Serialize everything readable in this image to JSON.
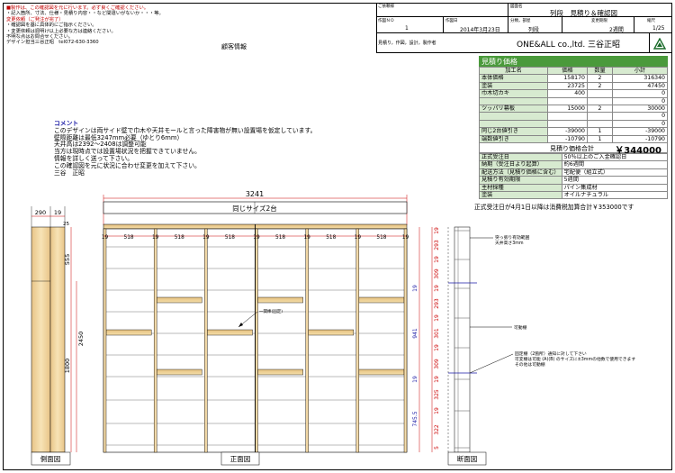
{
  "notes": {
    "red_lines": [
      {
        "prefix": "■",
        "text": "製作は、この確認図を元に行います。必ず良くご確認ください。"
      },
      {
        "prefix": "",
        "text": "・記入箇所、寸法、仕様・見積り内容・・など間違いがないか・・・等。"
      },
      {
        "prefix": "",
        "text": "変更依頼（ご発注が完了）"
      },
      {
        "prefix": "",
        "text": "・確認図を基に具体的にご指示ください。"
      },
      {
        "prefix": "",
        "text": "・変更依頼は週明け以上必要な方は連絡ください。"
      }
    ],
    "black_lines": [
      "不明な点はお問合せください。",
      "デザイン担当三谷正昭　tel072-630-3360"
    ]
  },
  "customer_info_label": "顧客情報",
  "title_block": {
    "confirm_label": "ご依頼様",
    "confirm_value": "",
    "drawing_name_label": "図面名",
    "drawing_name_value": "列段　見積り＆確認図",
    "no_label": "作図ＮＯ",
    "no_value": "1",
    "date_label": "作図日",
    "date_value": "2014年3月23日",
    "class_label": "分類，部屋",
    "class_value": "列段",
    "period_label": "変更期限",
    "period_value": "2週間",
    "scale_label": "縮尺",
    "scale_value": "1/25",
    "maker_label": "見積り，作図，設計，製作者",
    "maker_value": "ONE&ALL co.,ltd. 三谷正昭"
  },
  "estimate": {
    "title": "見積り価格",
    "headers": [
      "加工名",
      "価格",
      "数量",
      "小計"
    ],
    "rows": [
      [
        "本体価格",
        "158170",
        "2",
        "316340"
      ],
      [
        "塗装",
        "23725",
        "2",
        "47450"
      ],
      [
        "巾木切カキ",
        "400",
        "",
        "0"
      ],
      [
        "",
        "",
        "",
        "0"
      ],
      [
        "ツッパリ幕板",
        "15000",
        "2",
        "30000"
      ],
      [
        "",
        "",
        "",
        "0"
      ],
      [
        "",
        "",
        "",
        "0"
      ],
      [
        "同じ2台値引き",
        "-39000",
        "1",
        "-39000"
      ],
      [
        "端数値引き",
        "-10790",
        "1",
        "-10790"
      ]
    ],
    "total_label": "見積り価格合計",
    "total_value": "￥344000"
  },
  "conditions": [
    [
      "正式受注日",
      "50％以上のご入金確認日"
    ],
    [
      "納期（受注日より起算）",
      "約6週間"
    ],
    [
      "配送方法（見積り価格に含む）",
      "宅配便（組立式）"
    ],
    [
      "見積り有効期限",
      "5週間"
    ],
    [
      "主材採種",
      "パイン集成材"
    ],
    [
      "塗装",
      "オイルナチュラル"
    ]
  ],
  "tax_note": "正式受注日が4月1日以降は消費税加算合計￥353000です",
  "comment": {
    "title": "コメント",
    "lines": [
      "このデザインは両サイド壁で巾木や天井モールと言った障害物が無い設置場を仮定しています。",
      "壁際距離は最低3247mm必要（ゆとり6mm）",
      "天井高は2392〜2408は調整可能",
      "当方は現時点では設置場状況を把握できていません。",
      "情報を詳しく送って下さい。",
      "この確認図を元に状況に合わせ変更を加えて下さい。",
      "三谷　正昭"
    ]
  },
  "drawing": {
    "width_total": "3241",
    "unit_label": "同じサイズ2台",
    "side_dims": {
      "w1": "290",
      "w2": "19",
      "top": "25",
      "h1": "555",
      "h2": "2450",
      "h3": "1800"
    },
    "column_dims": [
      "19",
      "518",
      "19",
      "518",
      "19",
      "518",
      "19",
      "518",
      "19",
      "518",
      "19",
      "518",
      "19"
    ],
    "vertical_dims": [
      "19",
      "293",
      "19",
      "309",
      "19",
      "293",
      "19",
      "301",
      "19",
      "309",
      "19",
      "325",
      "19",
      "322",
      "5"
    ],
    "inner_dims": [
      "19",
      "941",
      "19",
      "745.5"
    ],
    "section_notes": [
      "突っ張り有効範囲\n天井高さ3mm",
      "可動棚",
      "固定棚（2箇所）通知に対して下さい\n可変棚は可能 (A)(B) のサイズに±3mmの他数で使用できます\nその他は可動棚"
    ],
    "shelf_note": "一関棒(固定)",
    "labels": {
      "side": "側面図",
      "front": "正面図",
      "section": "断面図"
    }
  }
}
